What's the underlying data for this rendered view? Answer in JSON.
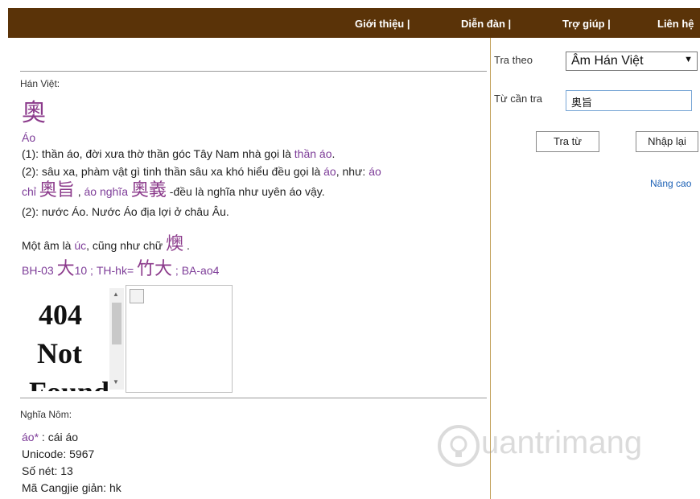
{
  "nav": {
    "items": [
      "Giới thiệu |",
      "Diễn đàn |",
      "Trợ giúp |",
      "Liên hệ"
    ]
  },
  "han_viet": {
    "label": "Hán Việt:",
    "char": "奧",
    "reading": "Áo",
    "line1_prefix": "(1): thần áo, đời xưa thờ thần góc Tây Nam nhà gọi là ",
    "line1_link": "thần áo",
    "line1_suffix": ".",
    "line2_prefix": "(2): sâu xa, phàm vật gì tinh thần sâu xa khó hiểu đều gọi là ",
    "line2_link1": "áo",
    "line2_mid": ", như: ",
    "line2_link2": "áo",
    "line3_link1": "chỉ",
    "line3_han1": "奧旨",
    "line3_sep": " , ",
    "line3_link2": "áo nghĩa",
    "line3_han2": "奧義",
    "line3_suffix": " -đều là nghĩa như uyên áo vậy.",
    "line4": "(2): nước Áo. Nước Áo địa lợi ở châu Âu.",
    "alt_prefix": "Một âm là ",
    "alt_link": "úc",
    "alt_mid": ", cũng như chữ ",
    "alt_han": "燠",
    "alt_suffix": " .",
    "codes_a": "BH-03 ",
    "codes_han1": "大",
    "codes_b": "10 ; TH-hk= ",
    "codes_han2": "竹大",
    "codes_c": " ; BA-ao4"
  },
  "iframe": {
    "line1": "404",
    "line2": "Not",
    "line3": "Found"
  },
  "nom": {
    "label": "Nghĩa Nôm:",
    "link": "áo*",
    "meaning": " : cái áo",
    "unicode": "Unicode: 5967",
    "strokes": "Số nét: 13",
    "cangjie": "Mã Cangjie giản: hk"
  },
  "search": {
    "mode_label": "Tra theo",
    "mode_value": "Âm Hán Việt",
    "word_label": "Từ cần tra",
    "word_value": "奥旨",
    "submit": "Tra từ",
    "reset": "Nhập lại",
    "advanced": "Nâng cao"
  },
  "watermark": {
    "text": "uantrimang"
  },
  "colors": {
    "topbar": "#5a3308",
    "link": "#7d3c98",
    "han": "#8b3a8b",
    "divider": "#c2a05a"
  }
}
